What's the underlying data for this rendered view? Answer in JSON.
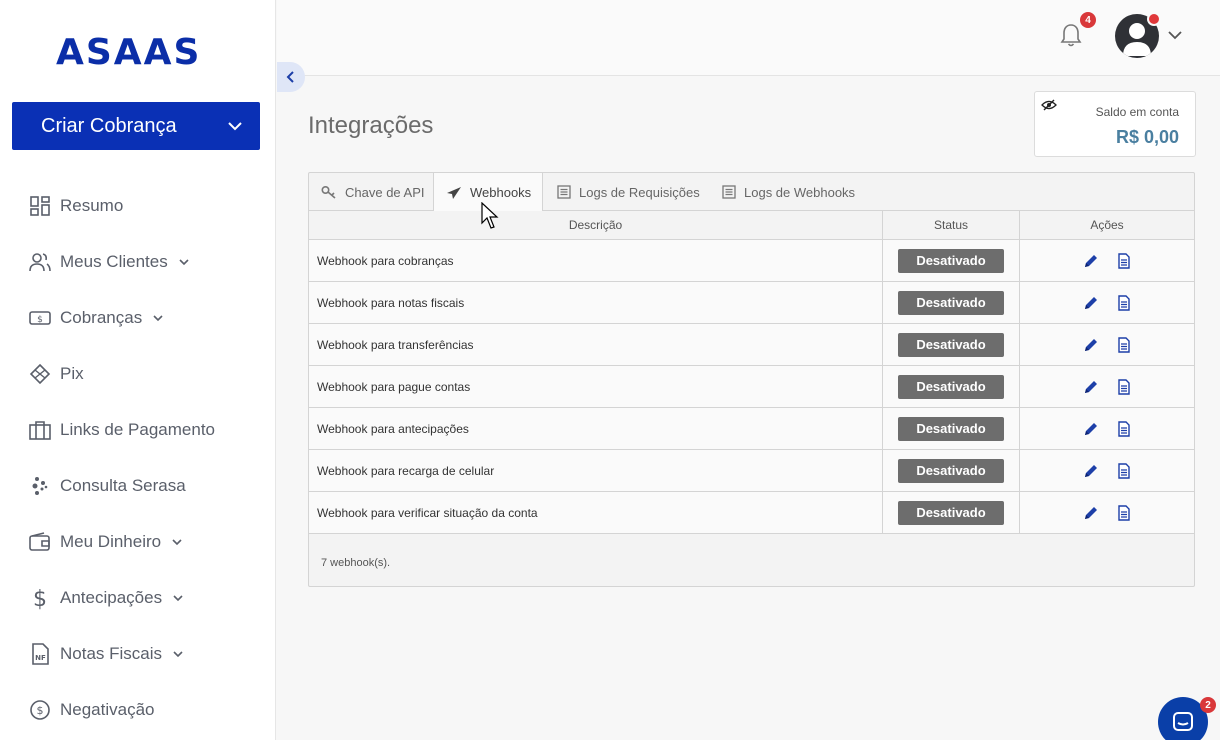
{
  "brand": {
    "logo_text": "ASAAS",
    "color": "#0b2ea8"
  },
  "sidebar": {
    "create_button": "Criar Cobrança",
    "items": [
      {
        "label": "Resumo",
        "icon": "grid-icon",
        "has_caret": false
      },
      {
        "label": "Meus Clientes",
        "icon": "users-icon",
        "has_caret": true
      },
      {
        "label": "Cobranças",
        "icon": "money-icon",
        "has_caret": true
      },
      {
        "label": "Pix",
        "icon": "pix-icon",
        "has_caret": false
      },
      {
        "label": "Links de Pagamento",
        "icon": "briefcase-icon",
        "has_caret": false
      },
      {
        "label": "Consulta Serasa",
        "icon": "serasa-icon",
        "has_caret": false
      },
      {
        "label": "Meu Dinheiro",
        "icon": "wallet-icon",
        "has_caret": true
      },
      {
        "label": "Antecipações",
        "icon": "dollar-icon",
        "has_caret": true
      },
      {
        "label": "Notas Fiscais",
        "icon": "invoice-icon",
        "has_caret": true
      },
      {
        "label": "Negativação",
        "icon": "coin-icon",
        "has_caret": false
      }
    ]
  },
  "header": {
    "notification_count": "4"
  },
  "main": {
    "title": "Integrações",
    "balance_label": "Saldo em conta",
    "balance_value": "R$ 0,00",
    "tabs": [
      {
        "label": "Chave de API",
        "icon": "key-icon"
      },
      {
        "label": "Webhooks",
        "icon": "send-icon",
        "active": true
      },
      {
        "label": "Logs de Requisições",
        "icon": "list-icon"
      },
      {
        "label": "Logs de Webhooks",
        "icon": "list-icon"
      }
    ],
    "table": {
      "columns": [
        "Descrição",
        "Status",
        "Ações"
      ],
      "rows": [
        {
          "description": "Webhook para cobranças",
          "status": "Desativado"
        },
        {
          "description": "Webhook para notas fiscais",
          "status": "Desativado"
        },
        {
          "description": "Webhook para transferências",
          "status": "Desativado"
        },
        {
          "description": "Webhook para pague contas",
          "status": "Desativado"
        },
        {
          "description": "Webhook para antecipações",
          "status": "Desativado"
        },
        {
          "description": "Webhook para recarga de celular",
          "status": "Desativado"
        },
        {
          "description": "Webhook para verificar situação da conta",
          "status": "Desativado"
        }
      ],
      "footer": "7 webhook(s)."
    }
  },
  "chat": {
    "badge": "2"
  }
}
